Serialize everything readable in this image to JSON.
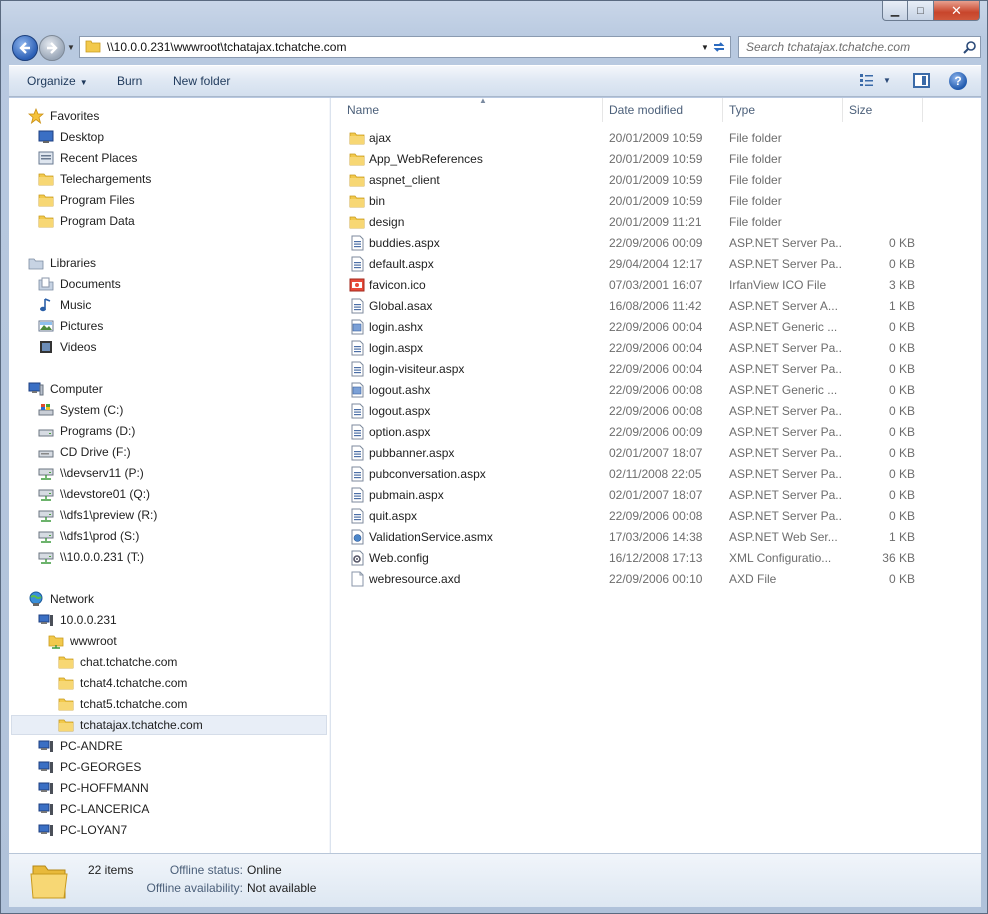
{
  "window": {
    "caption": {
      "minimize": "▁",
      "maximize": "□",
      "close": "✕"
    }
  },
  "address": {
    "path": "\\\\10.0.0.231\\wwwroot\\tchatajax.tchatche.com",
    "search_placeholder": "Search tchatajax.tchatche.com"
  },
  "toolbar": {
    "organize": "Organize",
    "burn": "Burn",
    "new_folder": "New folder",
    "help": "?"
  },
  "sidebar": {
    "favorites": {
      "label": "Favorites",
      "items": [
        "Desktop",
        "Recent Places",
        "Telechargements",
        "Program Files",
        "Program Data"
      ]
    },
    "libraries": {
      "label": "Libraries",
      "items": [
        "Documents",
        "Music",
        "Pictures",
        "Videos"
      ]
    },
    "computer": {
      "label": "Computer",
      "items": [
        "System (C:)",
        "Programs (D:)",
        "CD Drive (F:)",
        "\\\\devserv11 (P:)",
        "\\\\devstore01 (Q:)",
        "\\\\dfs1\\preview (R:)",
        "\\\\dfs1\\prod (S:)",
        "\\\\10.0.0.231 (T:)"
      ]
    },
    "network": {
      "label": "Network",
      "host": "10.0.0.231",
      "share": "wwwroot",
      "folders": [
        "chat.tchatche.com",
        "tchat4.tchatche.com",
        "tchat5.tchatche.com",
        "tchatajax.tchatche.com"
      ],
      "pcs": [
        "PC-ANDRE",
        "PC-GEORGES",
        "PC-HOFFMANN",
        "PC-LANCERICA",
        "PC-LOYAN7"
      ]
    }
  },
  "columns": {
    "name": "Name",
    "date": "Date modified",
    "type": "Type",
    "size": "Size"
  },
  "files": [
    {
      "icon": "folder",
      "name": "ajax",
      "date": "20/01/2009 10:59",
      "type": "File folder",
      "size": ""
    },
    {
      "icon": "folder",
      "name": "App_WebReferences",
      "date": "20/01/2009 10:59",
      "type": "File folder",
      "size": ""
    },
    {
      "icon": "folder",
      "name": "aspnet_client",
      "date": "20/01/2009 10:59",
      "type": "File folder",
      "size": ""
    },
    {
      "icon": "folder",
      "name": "bin",
      "date": "20/01/2009 10:59",
      "type": "File folder",
      "size": ""
    },
    {
      "icon": "folder",
      "name": "design",
      "date": "20/01/2009 11:21",
      "type": "File folder",
      "size": ""
    },
    {
      "icon": "aspx",
      "name": "buddies.aspx",
      "date": "22/09/2006 00:09",
      "type": "ASP.NET Server Pa...",
      "size": "0 KB"
    },
    {
      "icon": "aspx",
      "name": "default.aspx",
      "date": "29/04/2004 12:17",
      "type": "ASP.NET Server Pa...",
      "size": "0 KB"
    },
    {
      "icon": "ico",
      "name": "favicon.ico",
      "date": "07/03/2001 16:07",
      "type": "IrfanView ICO File",
      "size": "3 KB"
    },
    {
      "icon": "aspx",
      "name": "Global.asax",
      "date": "16/08/2006 11:42",
      "type": "ASP.NET Server A...",
      "size": "1 KB"
    },
    {
      "icon": "ashx",
      "name": "login.ashx",
      "date": "22/09/2006 00:04",
      "type": "ASP.NET Generic ...",
      "size": "0 KB"
    },
    {
      "icon": "aspx",
      "name": "login.aspx",
      "date": "22/09/2006 00:04",
      "type": "ASP.NET Server Pa...",
      "size": "0 KB"
    },
    {
      "icon": "aspx",
      "name": "login-visiteur.aspx",
      "date": "22/09/2006 00:04",
      "type": "ASP.NET Server Pa...",
      "size": "0 KB"
    },
    {
      "icon": "ashx",
      "name": "logout.ashx",
      "date": "22/09/2006 00:08",
      "type": "ASP.NET Generic ...",
      "size": "0 KB"
    },
    {
      "icon": "aspx",
      "name": "logout.aspx",
      "date": "22/09/2006 00:08",
      "type": "ASP.NET Server Pa...",
      "size": "0 KB"
    },
    {
      "icon": "aspx",
      "name": "option.aspx",
      "date": "22/09/2006 00:09",
      "type": "ASP.NET Server Pa...",
      "size": "0 KB"
    },
    {
      "icon": "aspx",
      "name": "pubbanner.aspx",
      "date": "02/01/2007 18:07",
      "type": "ASP.NET Server Pa...",
      "size": "0 KB"
    },
    {
      "icon": "aspx",
      "name": "pubconversation.aspx",
      "date": "02/11/2008 22:05",
      "type": "ASP.NET Server Pa...",
      "size": "0 KB"
    },
    {
      "icon": "aspx",
      "name": "pubmain.aspx",
      "date": "02/01/2007 18:07",
      "type": "ASP.NET Server Pa...",
      "size": "0 KB"
    },
    {
      "icon": "aspx",
      "name": "quit.aspx",
      "date": "22/09/2006 00:08",
      "type": "ASP.NET Server Pa...",
      "size": "0 KB"
    },
    {
      "icon": "asmx",
      "name": "ValidationService.asmx",
      "date": "17/03/2006 14:38",
      "type": "ASP.NET Web Ser...",
      "size": "1 KB"
    },
    {
      "icon": "config",
      "name": "Web.config",
      "date": "16/12/2008 17:13",
      "type": "XML Configuratio...",
      "size": "36 KB"
    },
    {
      "icon": "blank",
      "name": "webresource.axd",
      "date": "22/09/2006 00:10",
      "type": "AXD File",
      "size": "0 KB"
    }
  ],
  "details": {
    "count": "22 items",
    "offline_status_label": "Offline status:",
    "offline_status_value": "Online",
    "offline_avail_label": "Offline availability:",
    "offline_avail_value": "Not available"
  }
}
